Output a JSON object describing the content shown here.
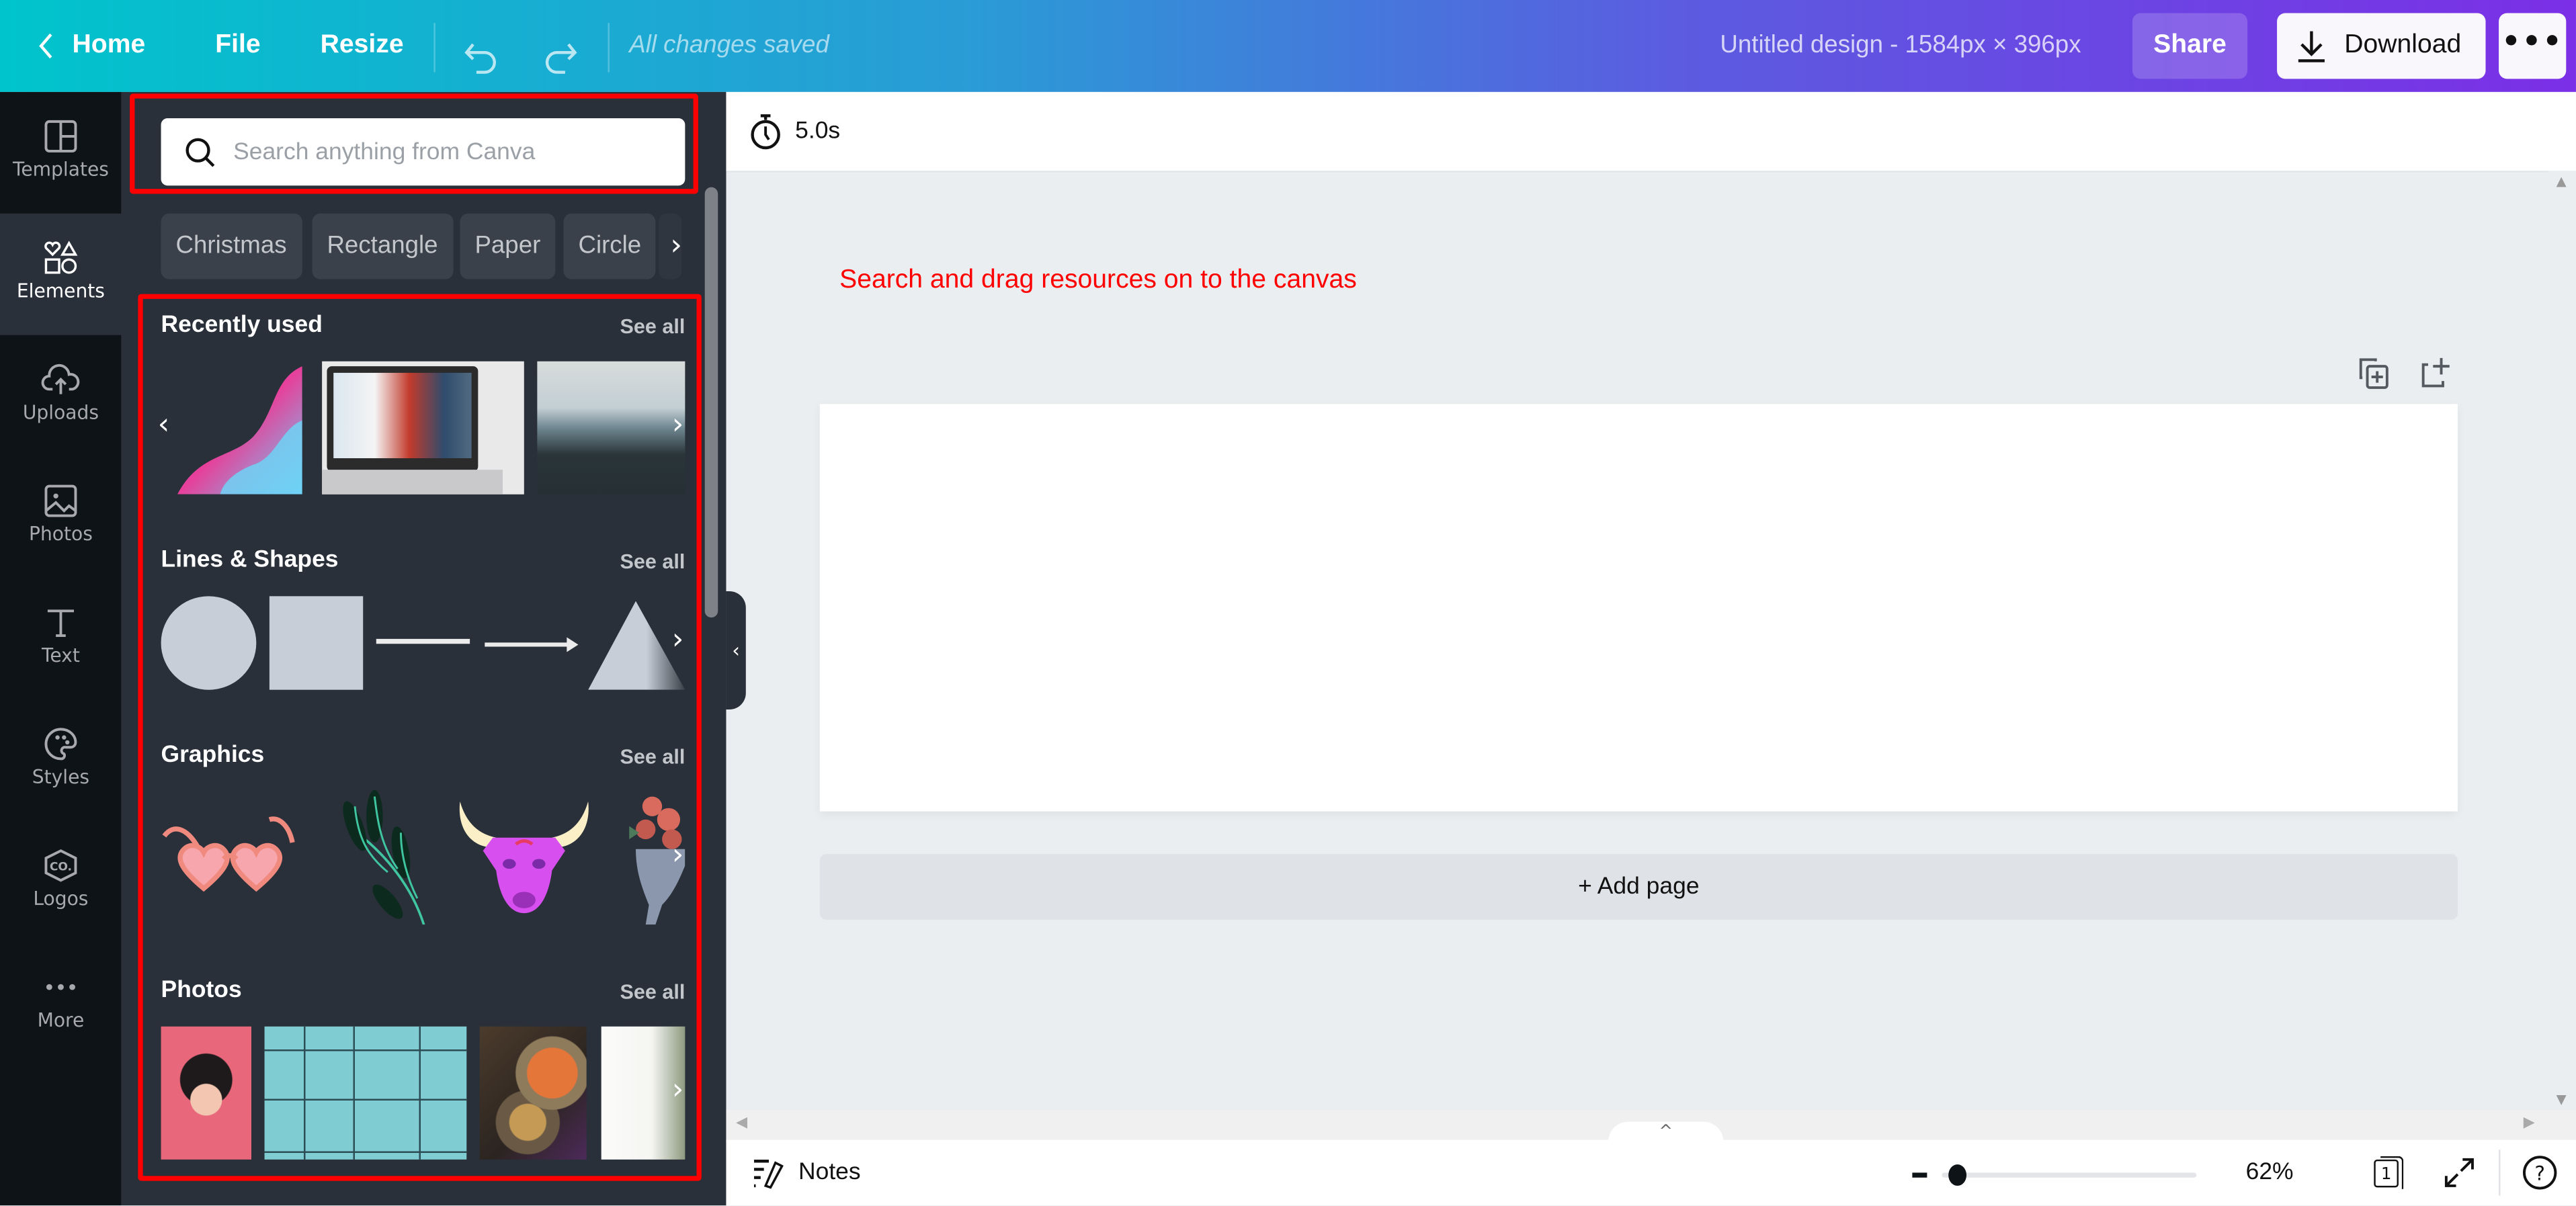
{
  "topbar": {
    "home_label": "Home",
    "file_label": "File",
    "resize_label": "Resize",
    "save_status": "All changes saved",
    "doc_title": "Untitled design - 1584px × 396px",
    "share_label": "Share",
    "download_label": "Download",
    "more_label": "•••"
  },
  "rail": {
    "items": [
      {
        "label": "Templates",
        "icon": "templates-icon"
      },
      {
        "label": "Elements",
        "icon": "elements-icon",
        "active": true
      },
      {
        "label": "Uploads",
        "icon": "cloud-upload-icon"
      },
      {
        "label": "Photos",
        "icon": "image-icon"
      },
      {
        "label": "Text",
        "icon": "text-icon"
      },
      {
        "label": "Styles",
        "icon": "palette-icon"
      },
      {
        "label": "Logos",
        "icon": "logo-hexagon-icon"
      },
      {
        "label": "More",
        "icon": "more-dots-icon"
      }
    ]
  },
  "panel": {
    "search": {
      "placeholder": "Search anything from Canva",
      "value": ""
    },
    "chips": [
      "Christmas",
      "Rectangle",
      "Paper",
      "Circle"
    ],
    "sections": {
      "recent": {
        "title": "Recently used",
        "see_all": "See all",
        "items": [
          "purple-wave-shape",
          "laptop-photo",
          "misty-forest-photo"
        ]
      },
      "shapes": {
        "title": "Lines & Shapes",
        "see_all": "See all",
        "items": [
          "circle",
          "square",
          "line",
          "arrow-line",
          "triangle"
        ]
      },
      "graphics": {
        "title": "Graphics",
        "see_all": "See all",
        "items": [
          "heart-sunglasses",
          "green-leaf-branch",
          "pink-bull-head",
          "flower-vase"
        ]
      },
      "photos": {
        "title": "Photos",
        "see_all": "See all",
        "items": [
          "woman-pink-balls",
          "glass-building-windows",
          "diwali-food",
          "white-flower"
        ]
      }
    }
  },
  "editor": {
    "duration": "5.0s",
    "annotation": "Search and drag resources on to the canvas",
    "add_page_label": "+ Add page"
  },
  "bottombar": {
    "notes_label": "Notes",
    "zoom_percent": "62%",
    "zoom_fraction": 0.1,
    "page_count": "1"
  },
  "colors": {
    "highlight": "#ff0000",
    "panel_bg": "#293039",
    "rail_bg": "#0e1318"
  }
}
